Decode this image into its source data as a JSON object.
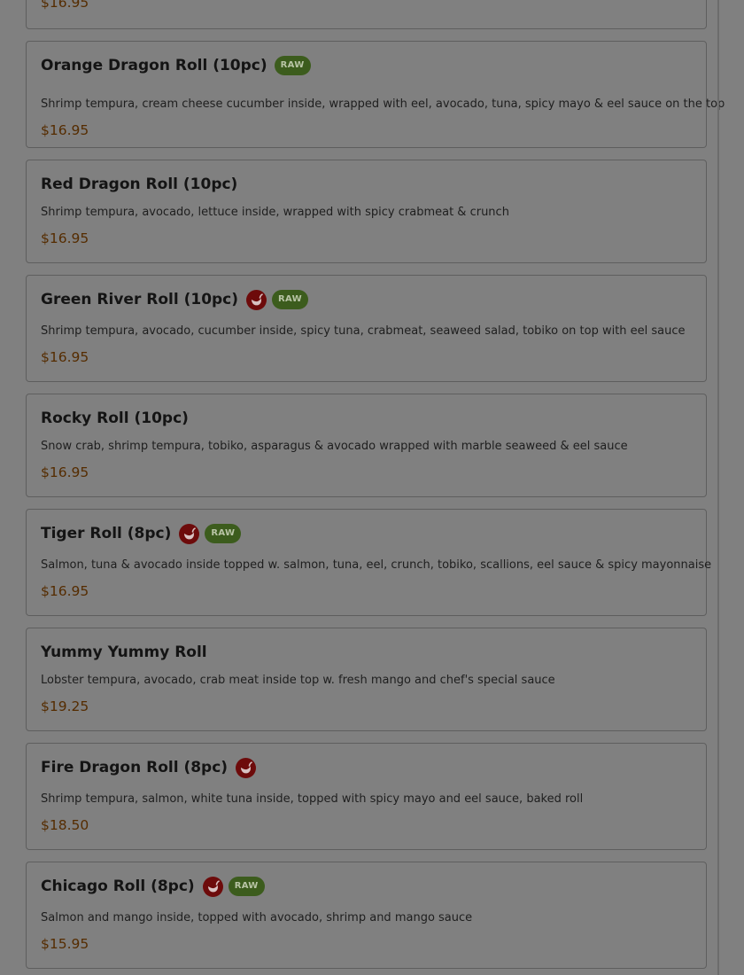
{
  "menu": {
    "raw_label": "RAW",
    "spicy_icon": "chili-pepper-icon",
    "colors": {
      "accent_price": "#552c00",
      "raw_badge": "#3c5c1d",
      "spicy_icon": "#6d0b0b"
    },
    "partial_item": {
      "price": "$16.95"
    },
    "items": [
      {
        "name": "Orange Dragon Roll (10pc)",
        "spicy": false,
        "raw": true,
        "description": "Shrimp tempura, cream cheese cucumber inside, wrapped with eel, avocado, tuna, spicy mayo & eel sauce on the top",
        "price": "$16.95"
      },
      {
        "name": "Red Dragon Roll (10pc)",
        "spicy": false,
        "raw": false,
        "description": "Shrimp tempura, avocado, lettuce inside, wrapped with spicy crabmeat & crunch",
        "price": "$16.95"
      },
      {
        "name": "Green River Roll (10pc)",
        "spicy": true,
        "raw": true,
        "description": "Shrimp tempura, avocado, cucumber inside, spicy tuna, crabmeat, seaweed salad, tobiko on top with eel sauce",
        "price": "$16.95"
      },
      {
        "name": "Rocky Roll (10pc)",
        "spicy": false,
        "raw": false,
        "description": "Snow crab, shrimp tempura, tobiko, asparagus & avocado wrapped with marble seaweed & eel sauce",
        "price": "$16.95"
      },
      {
        "name": "Tiger Roll (8pc)",
        "spicy": true,
        "raw": true,
        "description": "Salmon, tuna & avocado inside topped w. salmon, tuna, eel, crunch, tobiko, scallions, eel sauce & spicy mayonnaise",
        "price": "$16.95"
      },
      {
        "name": "Yummy Yummy Roll",
        "spicy": false,
        "raw": false,
        "description": "Lobster tempura, avocado, crab meat inside top w. fresh mango and chef's special sauce",
        "price": "$19.25"
      },
      {
        "name": "Fire Dragon Roll (8pc)",
        "spicy": true,
        "raw": false,
        "description": "Shrimp tempura, salmon, white tuna inside, topped with spicy mayo and eel sauce, baked roll",
        "price": "$18.50"
      },
      {
        "name": "Chicago Roll (8pc)",
        "spicy": true,
        "raw": true,
        "description": "Salmon and mango inside, topped with avocado, shrimp and mango sauce",
        "price": "$15.95"
      }
    ]
  }
}
